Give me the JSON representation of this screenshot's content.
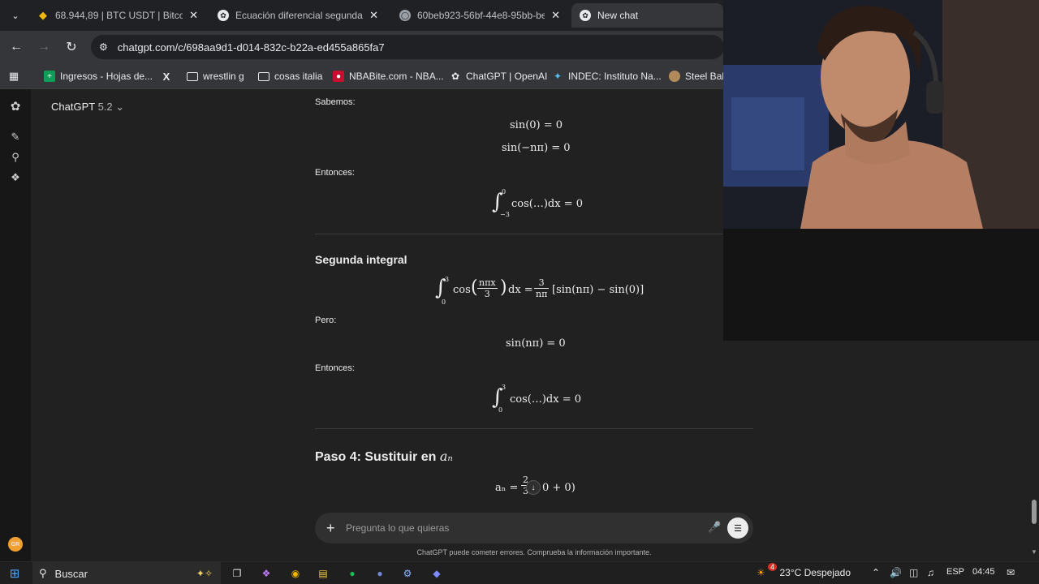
{
  "tabs": [
    {
      "title": "68.944,89 | BTC USDT | Bitcoin t",
      "favicon": "binance-icon",
      "active": false
    },
    {
      "title": "Ecuación diferencial segunda o",
      "favicon": "chatgpt-icon",
      "active": false
    },
    {
      "title": "60beb923-56bf-44e8-95bb-be",
      "favicon": "globe-icon",
      "active": false
    },
    {
      "title": "New chat",
      "favicon": "chatgpt-icon",
      "active": true
    }
  ],
  "address": {
    "url": "chatgpt.com/c/698aa9d1-d014-832c-b22a-ed455a865fa7"
  },
  "bookmarks": [
    {
      "label": "Ingresos - Hojas de...",
      "icon": "sheets-icon"
    },
    {
      "label": "",
      "icon": "x-icon"
    },
    {
      "label": "wrestlin g",
      "icon": "folder-icon"
    },
    {
      "label": "cosas italia",
      "icon": "folder-icon"
    },
    {
      "label": "NBABite.com - NBA...",
      "icon": "nba-icon"
    },
    {
      "label": "ChatGPT | OpenAI",
      "icon": "chatgpt-icon"
    },
    {
      "label": "INDEC: Instituto Na...",
      "icon": "indec-icon"
    },
    {
      "label": "Steel Ball",
      "icon": "steel-ball-icon"
    }
  ],
  "app": {
    "model_name": "ChatGPT",
    "model_version": "5.2",
    "avatar_initials": "GR"
  },
  "chat": {
    "sabemos": "Sabemos:",
    "eq1": "sin(0) = 0",
    "eq2": "sin(−nπ) = 0",
    "entonces1": "Entonces:",
    "int1_upper": "0",
    "int1_lower": "−3",
    "int1_body": "cos(…)dx = 0",
    "heading_segunda": "Segunda integral",
    "int2_upper": "3",
    "int2_lower": "0",
    "int2_cos": "cos",
    "int2_frac_num": "nπx",
    "int2_frac_den": "3",
    "int2_dx": "dx =",
    "int2_rhs_num": "3",
    "int2_rhs_den": "nπ",
    "int2_bracket": "[sin(nπ) − sin(0)]",
    "pero": "Pero:",
    "eq3": "sin(nπ) = 0",
    "entonces2": "Entonces:",
    "int3_upper": "3",
    "int3_lower": "0",
    "int3_body": "cos(…)dx = 0",
    "paso4_text": "Paso 4: Sustituir en",
    "paso4_var": "aₙ",
    "an_lhs": "aₙ =",
    "an_num": "2",
    "an_den": "3",
    "an_rest": "0 + 0)"
  },
  "composer": {
    "placeholder": "Pregunta lo que quieras",
    "disclaimer": "ChatGPT puede cometer errores. Comprueba la información importante."
  },
  "taskbar": {
    "search": "Buscar",
    "weather": "23°C  Despejado",
    "weather_badge": "4",
    "lang": "ESP",
    "time": "04:45"
  }
}
